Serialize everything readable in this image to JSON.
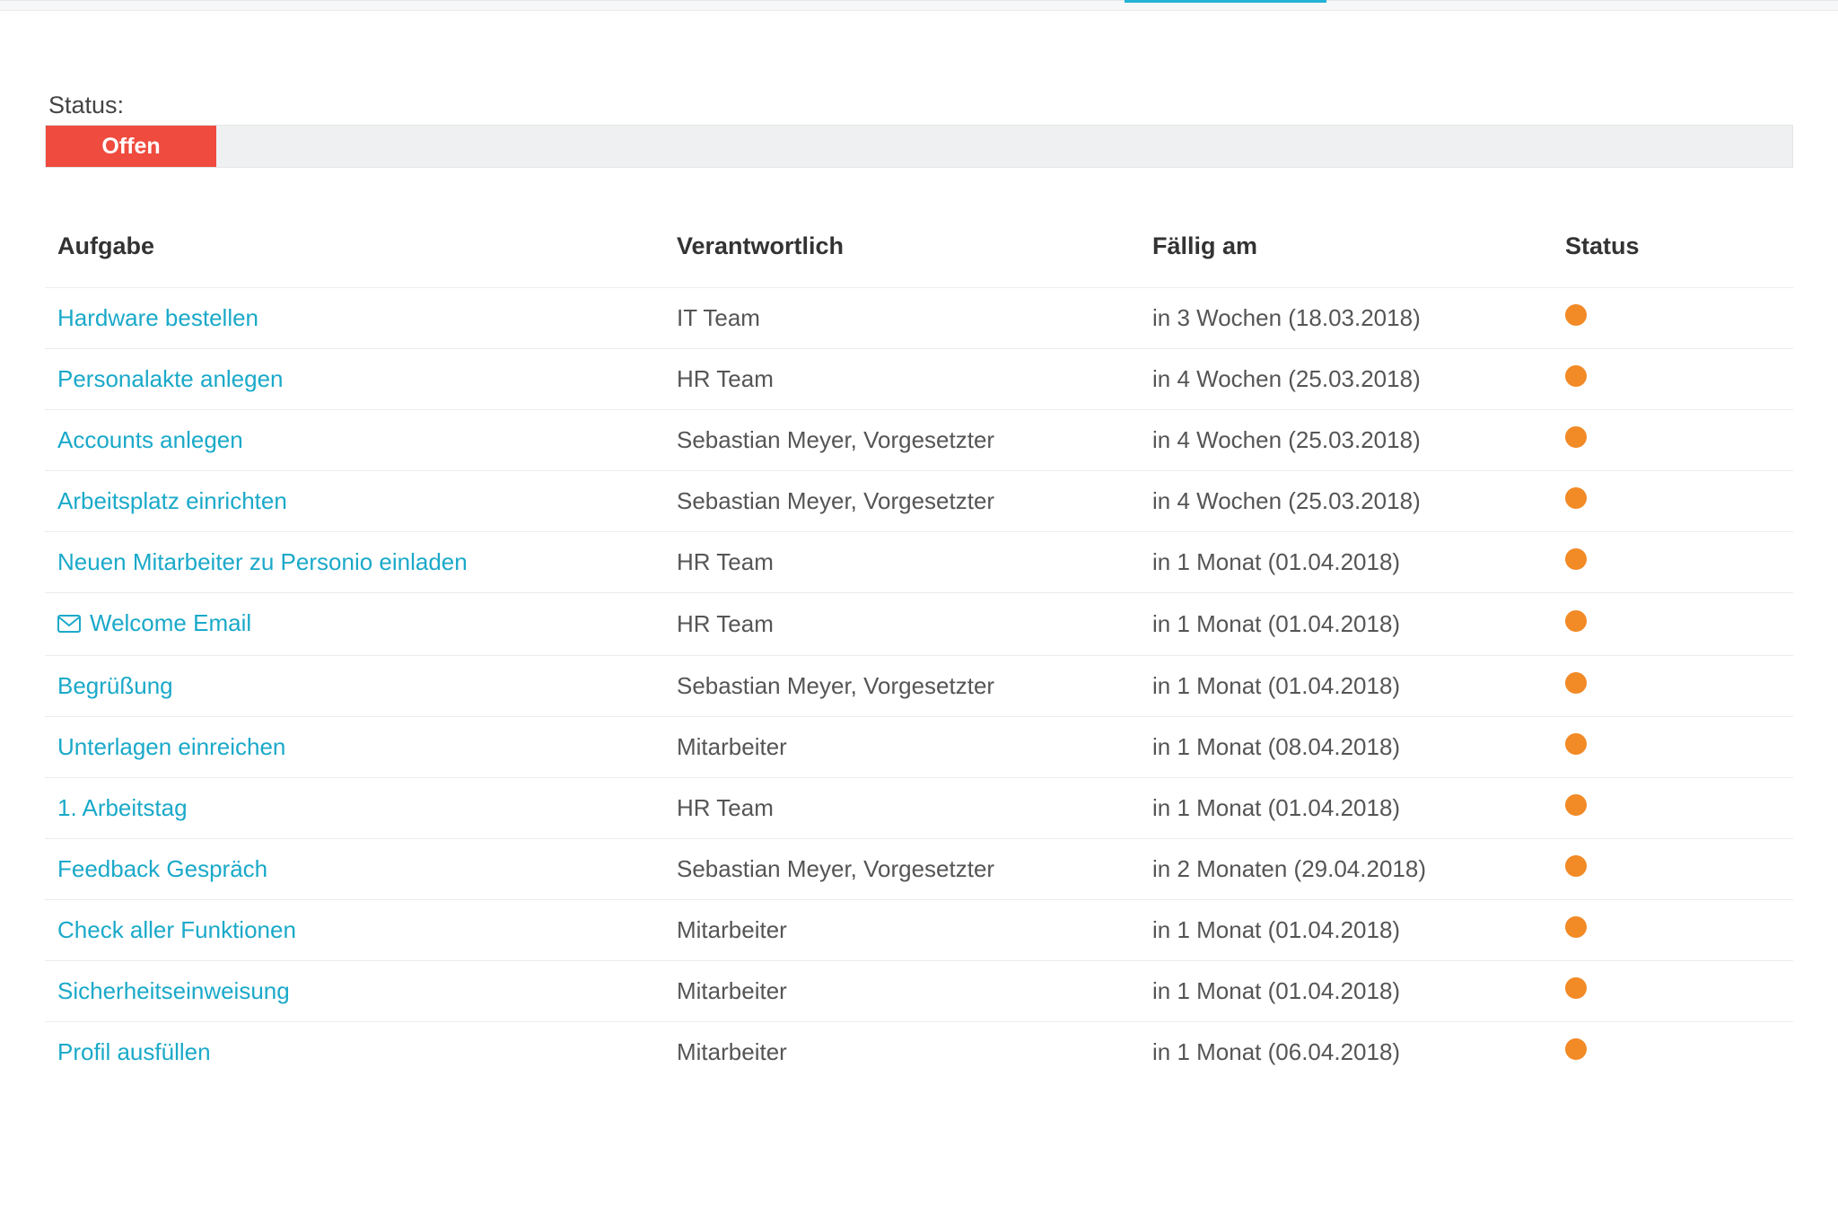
{
  "filter": {
    "label": "Status:",
    "value": "Offen"
  },
  "columns": {
    "task": "Aufgabe",
    "responsible": "Verantwortlich",
    "due": "Fällig am",
    "status": "Status"
  },
  "status_color": "#f28a26",
  "rows": [
    {
      "task": "Hardware bestellen",
      "icon": null,
      "responsible": "IT Team",
      "due": "in 3 Wochen (18.03.2018)"
    },
    {
      "task": "Personalakte anlegen",
      "icon": null,
      "responsible": "HR Team",
      "due": "in 4 Wochen (25.03.2018)"
    },
    {
      "task": "Accounts anlegen",
      "icon": null,
      "responsible": "Sebastian Meyer, Vorgesetzter",
      "due": "in 4 Wochen (25.03.2018)"
    },
    {
      "task": "Arbeitsplatz einrichten",
      "icon": null,
      "responsible": "Sebastian Meyer, Vorgesetzter",
      "due": "in 4 Wochen (25.03.2018)"
    },
    {
      "task": "Neuen Mitarbeiter zu Personio einladen",
      "icon": null,
      "responsible": "HR Team",
      "due": "in 1 Monat (01.04.2018)"
    },
    {
      "task": "Welcome Email",
      "icon": "mail",
      "responsible": "HR Team",
      "due": "in 1 Monat (01.04.2018)"
    },
    {
      "task": "Begrüßung",
      "icon": null,
      "responsible": "Sebastian Meyer, Vorgesetzter",
      "due": "in 1 Monat (01.04.2018)"
    },
    {
      "task": "Unterlagen einreichen",
      "icon": null,
      "responsible": "Mitarbeiter",
      "due": "in 1 Monat (08.04.2018)"
    },
    {
      "task": "1. Arbeitstag",
      "icon": null,
      "responsible": "HR Team",
      "due": "in 1 Monat (01.04.2018)"
    },
    {
      "task": "Feedback Gespräch",
      "icon": null,
      "responsible": "Sebastian Meyer, Vorgesetzter",
      "due": "in 2 Monaten (29.04.2018)"
    },
    {
      "task": "Check aller Funktionen",
      "icon": null,
      "responsible": "Mitarbeiter",
      "due": "in 1 Monat (01.04.2018)"
    },
    {
      "task": "Sicherheitseinweisung",
      "icon": null,
      "responsible": "Mitarbeiter",
      "due": "in 1 Monat (01.04.2018)"
    },
    {
      "task": "Profil ausfüllen",
      "icon": null,
      "responsible": "Mitarbeiter",
      "due": "in 1 Monat (06.04.2018)"
    }
  ]
}
